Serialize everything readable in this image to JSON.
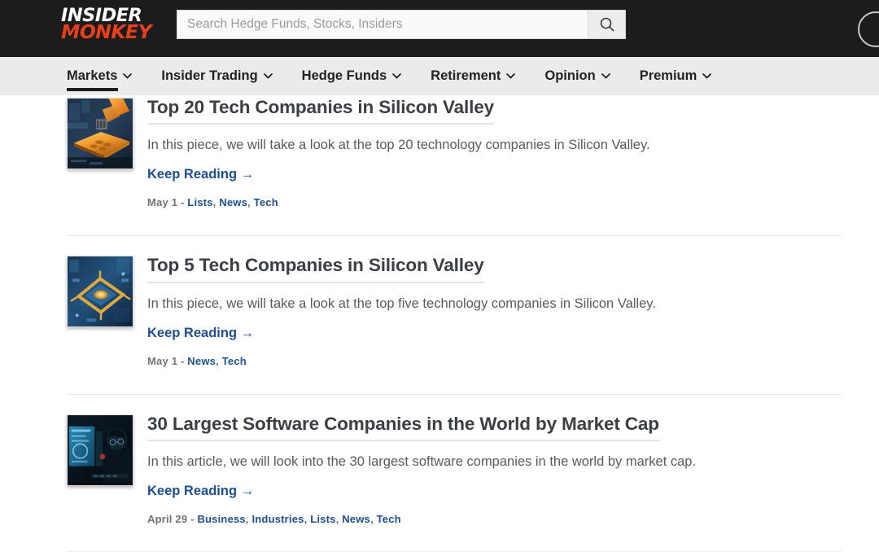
{
  "header": {
    "logo": {
      "line1": "INSIDER",
      "line2": "MONKEY"
    },
    "search": {
      "placeholder": "Search Hedge Funds, Stocks, Insiders",
      "value": "",
      "button_icon": "search-icon"
    },
    "account_icon": "account-circle-icon",
    "colors": {
      "bar_bg": "#1c1c1c",
      "logo_accent": "#e8401a"
    }
  },
  "nav": {
    "items": [
      {
        "label": "Markets",
        "active": true
      },
      {
        "label": "Insider Trading",
        "active": false
      },
      {
        "label": "Hedge Funds",
        "active": false
      },
      {
        "label": "Retirement",
        "active": false
      },
      {
        "label": "Opinion",
        "active": false
      },
      {
        "label": "Premium",
        "active": false
      }
    ],
    "colors": {
      "bg": "#ebebeb",
      "active_underline": "#1c1c1c"
    }
  },
  "articles": [
    {
      "title": "Top 20 Tech Companies in Silicon Valley",
      "description": "In this piece, we will take a look at the top 20 technology companies in Silicon Valley.",
      "keep_reading": "Keep Reading →",
      "date": "May 1",
      "separator": " - ",
      "tags": [
        "Lists",
        "News",
        "Tech"
      ],
      "thumb_alt": "robotic-arm-over-orange-circuit-board"
    },
    {
      "title": "Top 5 Tech Companies in Silicon Valley",
      "description": "In this piece, we will take a look at the top five technology companies in Silicon Valley.",
      "keep_reading": "Keep Reading →",
      "date": "May 1",
      "separator": " - ",
      "tags": [
        "News",
        "Tech"
      ],
      "thumb_alt": "blue-circuit-board-with-gold-traces"
    },
    {
      "title": "30 Largest Software Companies in the World by Market Cap",
      "description": "In this article, we will look into the 30 largest software companies in the world by market cap.",
      "keep_reading": "Keep Reading →",
      "date": "April 29",
      "separator": " - ",
      "tags": [
        "Business",
        "Industries",
        "Lists",
        "News",
        "Tech"
      ],
      "thumb_alt": "person-at-glowing-computer-screen"
    }
  ],
  "colors": {
    "link": "#1d4f91",
    "title": "#3a3f46",
    "body_text": "#555b61",
    "meta_gray": "#6e747a",
    "divider": "#e8e8e8"
  }
}
